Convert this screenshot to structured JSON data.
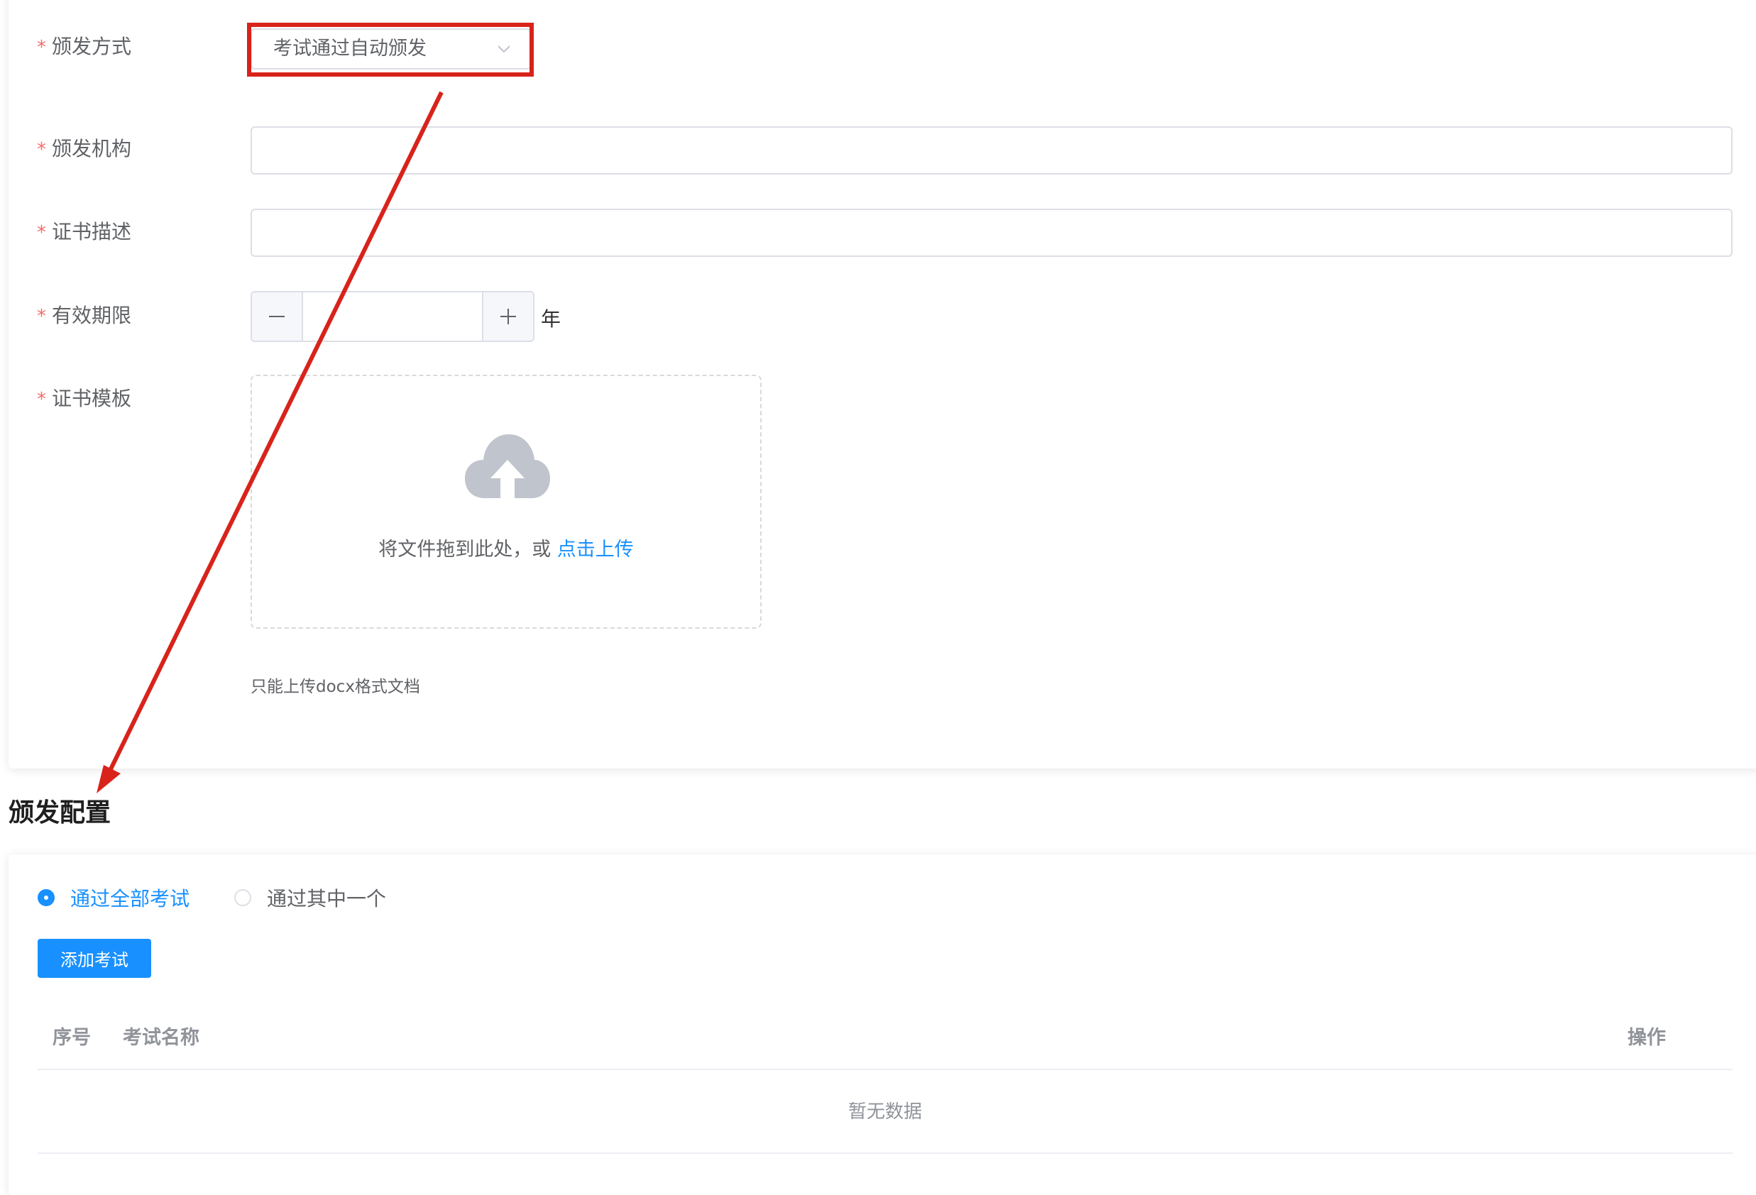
{
  "form": {
    "issue_method": {
      "label": "颁发方式",
      "value": "考试通过自动颁发"
    },
    "issuing_org": {
      "label": "颁发机构",
      "value": ""
    },
    "cert_description": {
      "label": "证书描述",
      "value": ""
    },
    "validity": {
      "label": "有效期限",
      "value": "",
      "unit": "年"
    },
    "template": {
      "label": "证书模板",
      "drag_text": "将文件拖到此处，或",
      "click_upload": "点击上传",
      "tip": "只能上传docx格式文档"
    },
    "required_mark": "*"
  },
  "config": {
    "title": "颁发配置",
    "radios": [
      {
        "label": "通过全部考试",
        "checked": true
      },
      {
        "label": "通过其中一个",
        "checked": false
      }
    ],
    "add_button": "添加考试",
    "table": {
      "columns": [
        "序号",
        "考试名称",
        "操作"
      ],
      "empty_text": "暂无数据"
    }
  },
  "colors": {
    "primary": "#1890ff",
    "required": "#f56c6c",
    "annotation": "#d8231b"
  },
  "icons": {
    "select_arrow": "chevron-down-icon",
    "minus": "minus-icon",
    "plus": "plus-icon",
    "upload": "cloud-upload-icon"
  }
}
